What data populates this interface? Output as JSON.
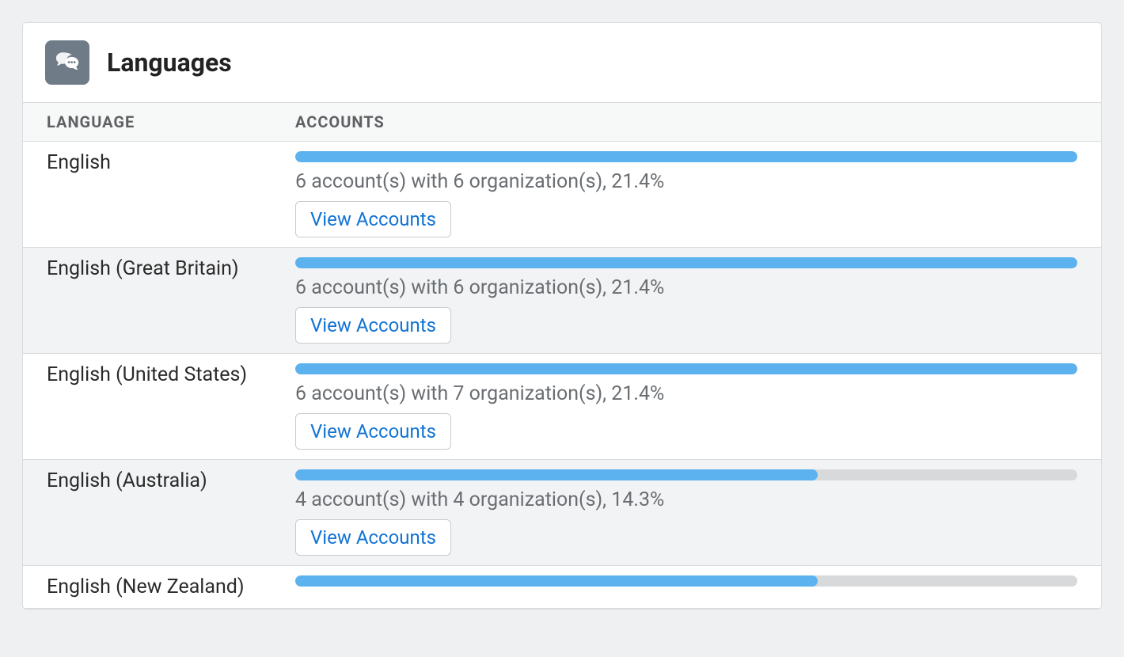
{
  "panel": {
    "title": "Languages",
    "columns": {
      "language": "LANGUAGE",
      "accounts": "ACCOUNTS"
    }
  },
  "view_button_label": "View Accounts",
  "max_percent": 21.4,
  "rows": [
    {
      "language": "English",
      "summary": "6 account(s) with 6 organization(s), 21.4%",
      "percent": 21.4
    },
    {
      "language": "English (Great Britain)",
      "summary": "6 account(s) with 6 organization(s), 21.4%",
      "percent": 21.4
    },
    {
      "language": "English (United States)",
      "summary": "6 account(s) with 7 organization(s), 21.4%",
      "percent": 21.4
    },
    {
      "language": "English (Australia)",
      "summary": "4 account(s) with 4 organization(s), 14.3%",
      "percent": 14.3
    },
    {
      "language": "English (New Zealand)",
      "summary": "",
      "percent": 14.3
    }
  ],
  "chart_data": {
    "type": "bar",
    "title": "Languages",
    "xlabel": "",
    "ylabel": "Accounts %",
    "ylim": [
      0,
      21.4
    ],
    "categories": [
      "English",
      "English (Great Britain)",
      "English (United States)",
      "English (Australia)",
      "English (New Zealand)"
    ],
    "values": [
      21.4,
      21.4,
      21.4,
      14.3,
      14.3
    ]
  }
}
